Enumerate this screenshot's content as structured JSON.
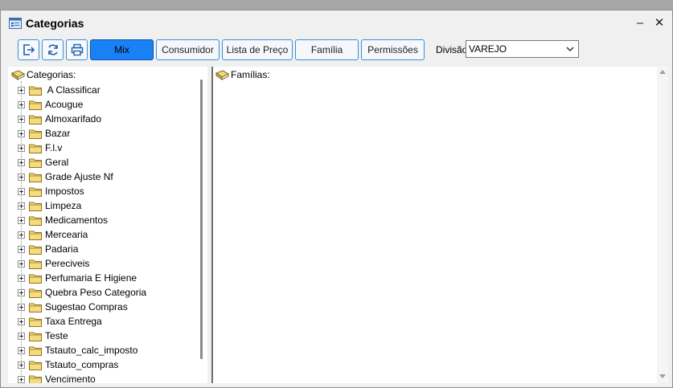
{
  "window": {
    "title": "Categorias",
    "minimize_glyph": "–",
    "close_glyph": "✕"
  },
  "toolbar": {
    "icons": [
      "exit-icon",
      "refresh-icon",
      "print-icon"
    ],
    "buttons": [
      "Mix",
      "Consumidor",
      "Lista de Preço",
      "Família",
      "Permissões"
    ],
    "division_label": "Divisão",
    "division_value": "VAREJO"
  },
  "colors": {
    "accent_border": "#3c8fd8",
    "mix_active": "#1a80f5"
  },
  "categories": {
    "root_label": "Categorias:",
    "items": [
      " A Classificar",
      "Acougue",
      "Almoxarifado",
      "Bazar",
      "F.l.v",
      "Geral",
      "Grade Ajuste Nf",
      "Impostos",
      "Limpeza",
      "Medicamentos",
      "Mercearia",
      "Padaria",
      "Pereciveis",
      "Perfumaria E Higiene",
      "Quebra Peso Categoria",
      "Sugestao Compras",
      "Taxa Entrega",
      "Teste",
      "Tstauto_calc_imposto",
      "Tstauto_compras",
      "Vencimento"
    ]
  },
  "families": {
    "root_label": "Famílias:"
  }
}
